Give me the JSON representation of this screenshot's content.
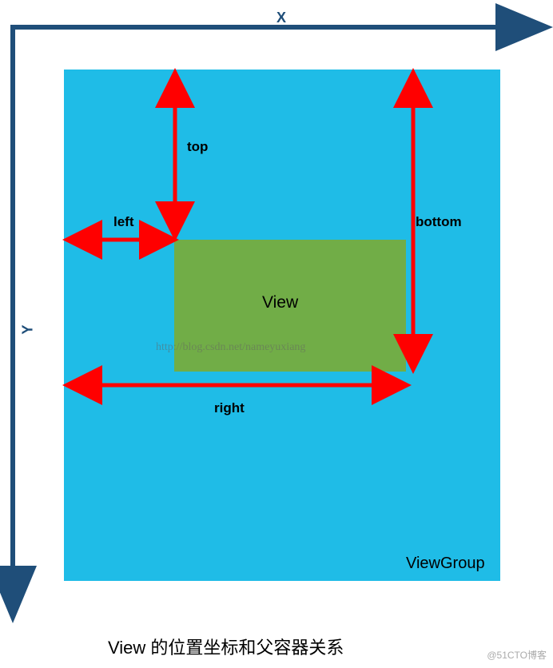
{
  "axes": {
    "xLabel": "X",
    "yLabel": "Y"
  },
  "labels": {
    "top": "top",
    "left": "left",
    "right": "right",
    "bottom": "bottom"
  },
  "elements": {
    "viewLabel": "View",
    "viewGroupLabel": "ViewGroup"
  },
  "watermarkUrl": "http://blog.csdn.net/nameyuxiang",
  "caption": "View 的位置坐标和父容器关系",
  "siteWatermark": "@51CTO博客",
  "colors": {
    "axis": "#1F4E79",
    "arrow": "#FF0000",
    "viewGroup": "#1FBCE7",
    "view": "#71AD47"
  }
}
